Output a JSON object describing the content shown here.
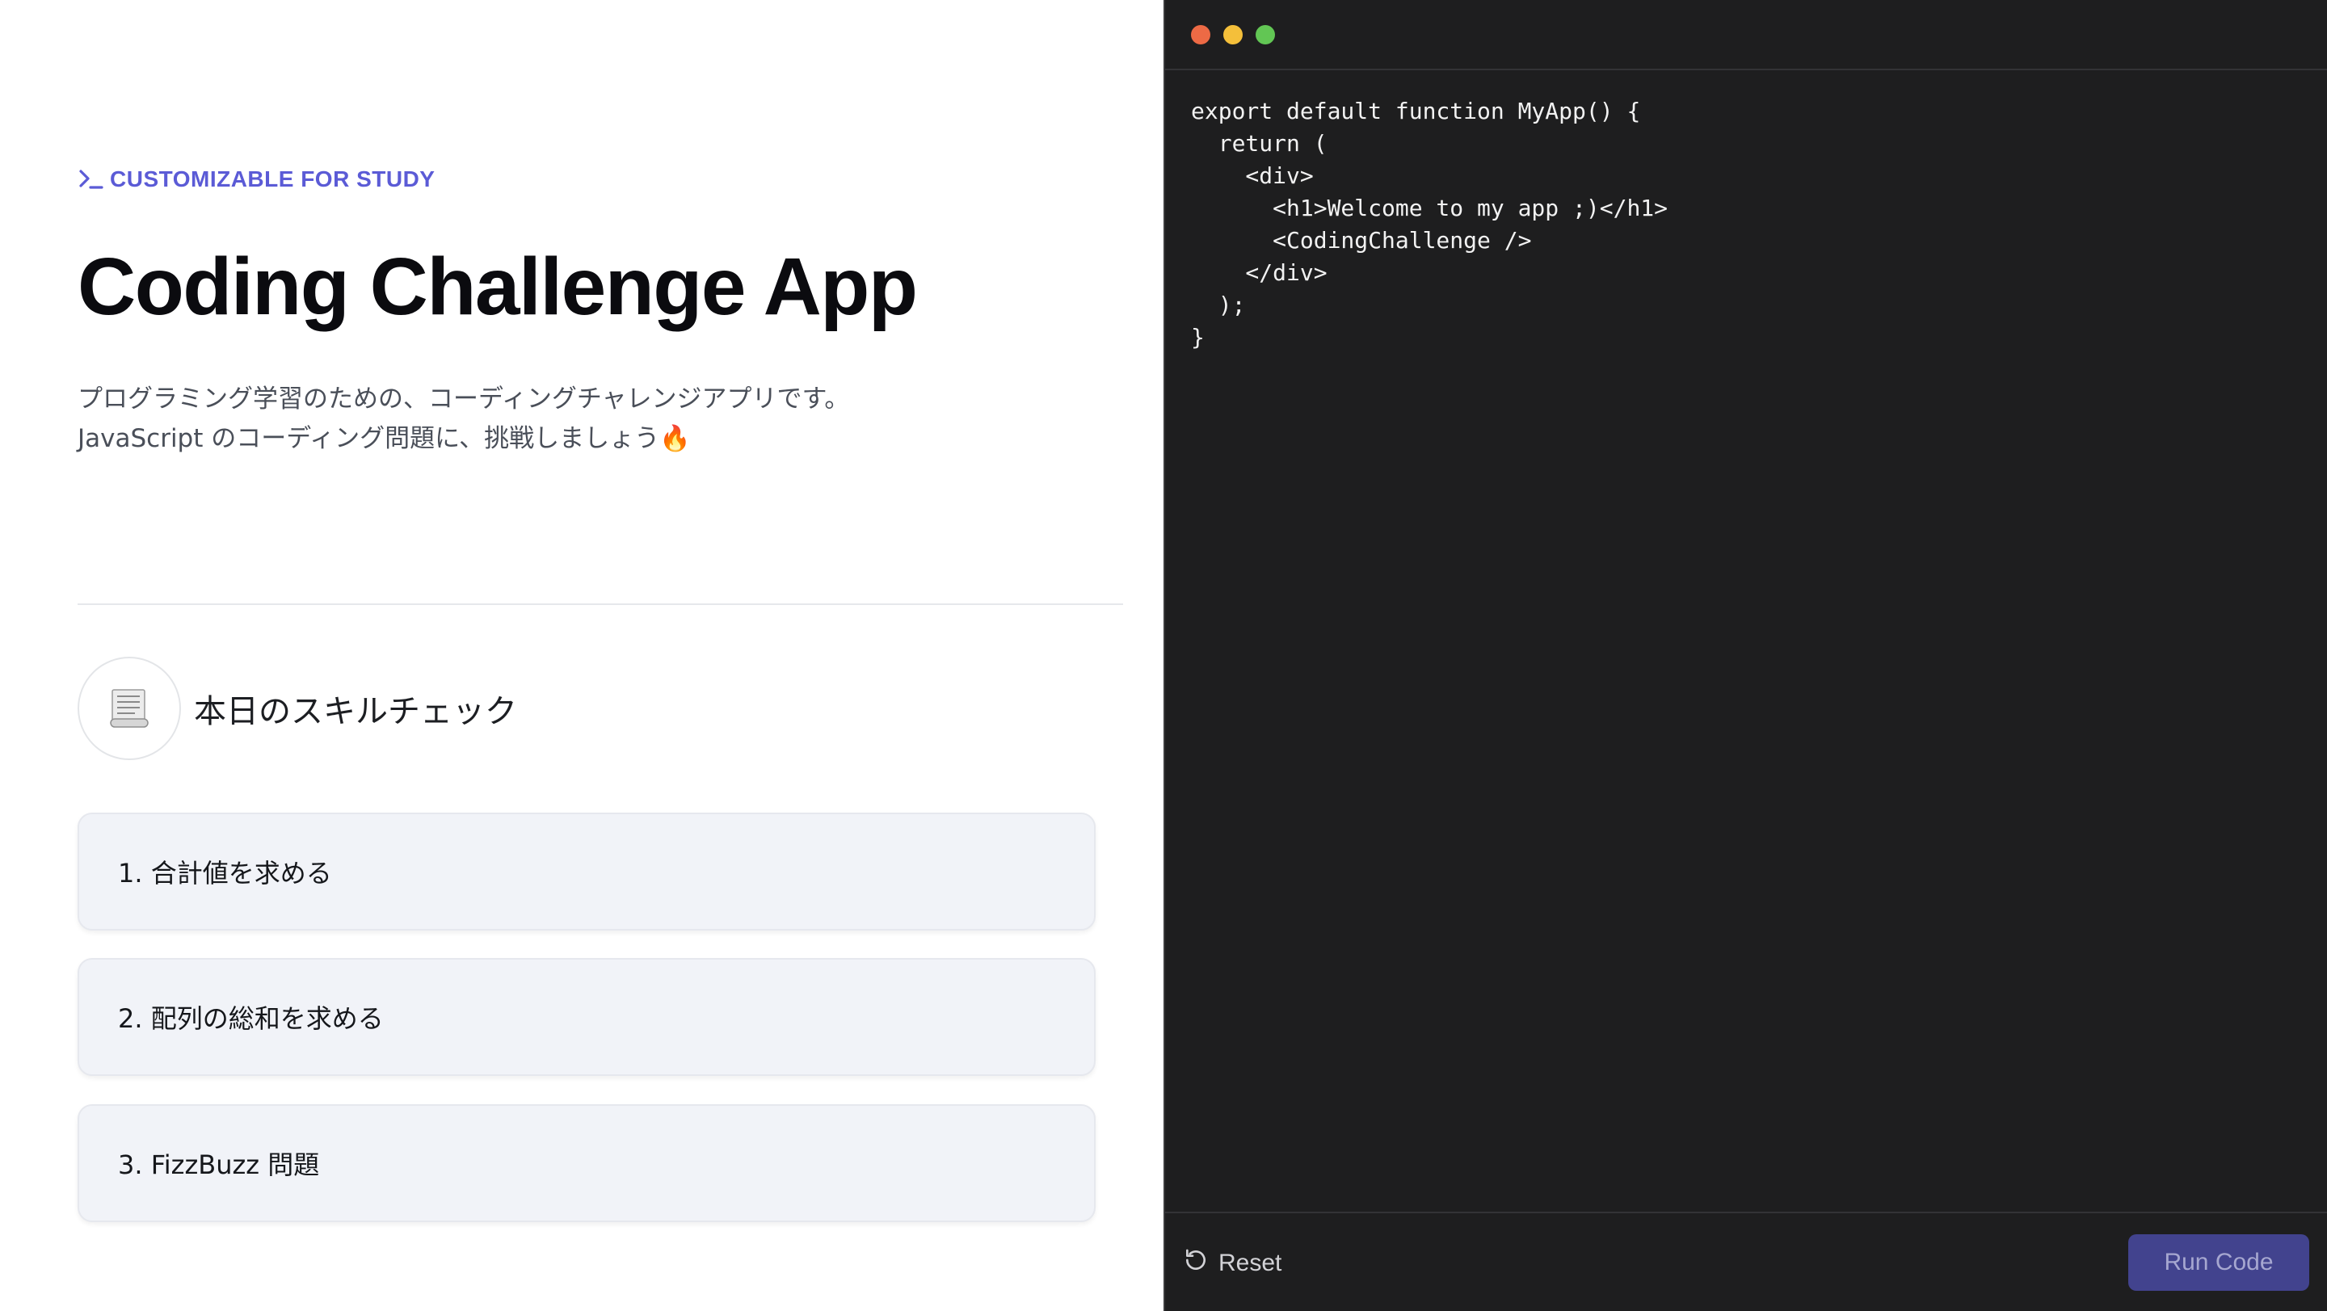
{
  "hero": {
    "eyebrow": "CUSTOMIZABLE FOR STUDY",
    "eyebrow_icon": "terminal-prompt-icon",
    "title": "Coding Challenge App",
    "description_line1": "プログラミング学習のための、コーディングチャレンジアプリです。",
    "description_line2": "JavaScript のコーディング問題に、挑戦しましょう🔥"
  },
  "skill_section": {
    "icon": "scroll-icon",
    "title": "本日のスキルチェック",
    "challenges": [
      {
        "label": "1. 合計値を求める"
      },
      {
        "label": "2. 配列の総和を求める"
      },
      {
        "label": "3. FizzBuzz 問題"
      }
    ]
  },
  "editor": {
    "window_controls": [
      "close",
      "minimize",
      "zoom"
    ],
    "code": "export default function MyApp() {\n  return (\n    <div>\n      <h1>Welcome to my app ;)</h1>\n      <CodingChallenge />\n    </div>\n  );\n}",
    "reset_label": "Reset",
    "reset_icon": "rotate-ccw-icon",
    "run_label": "Run Code"
  },
  "colors": {
    "accent": "#5b5bd6",
    "editor_bg": "#1e1e1f",
    "card_bg": "#f1f3f8",
    "run_button_bg": "#42438e"
  }
}
